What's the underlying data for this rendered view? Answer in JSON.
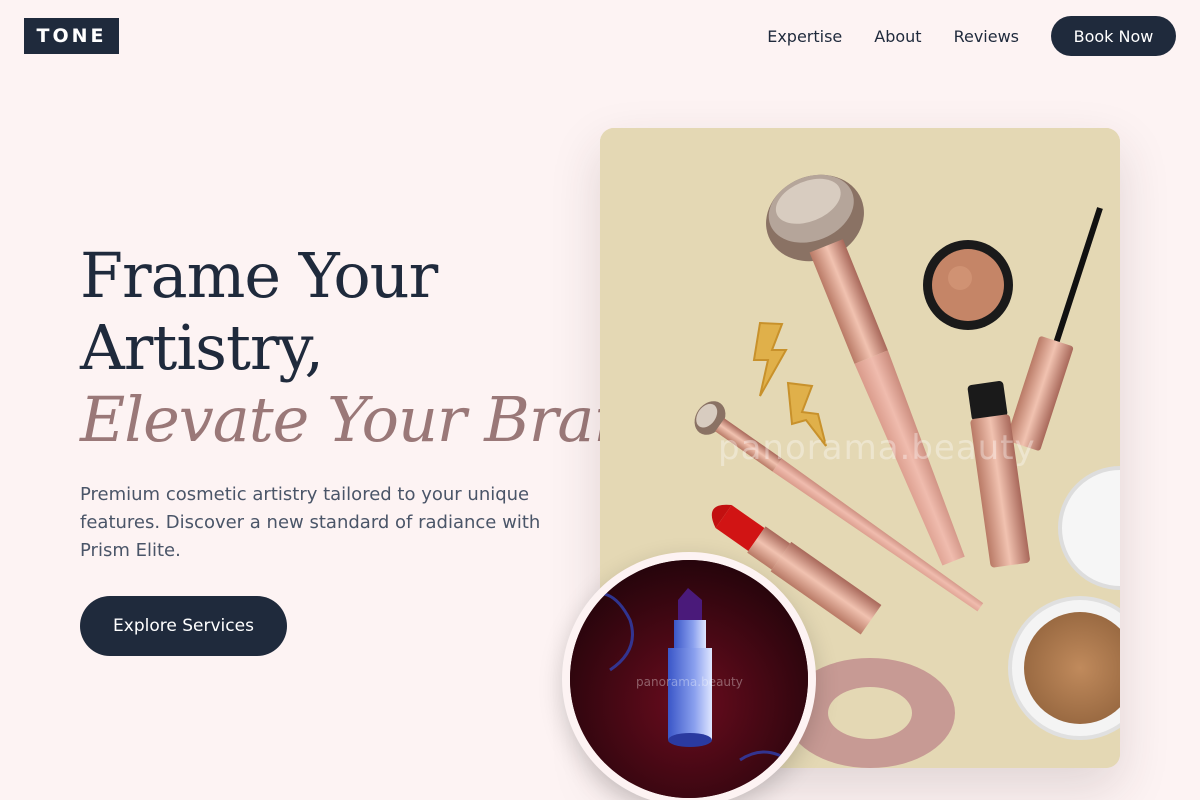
{
  "brand": {
    "logo": "TONE"
  },
  "nav": {
    "links": [
      "Expertise",
      "About",
      "Reviews"
    ],
    "cta": "Book Now"
  },
  "hero": {
    "headline_line1": "Frame Your",
    "headline_line2": "Artistry,",
    "headline_accent": "Elevate Your Brand.",
    "subtext": "Premium cosmetic artistry tailored to your unique features. Discover a new standard of radiance with Prism Elite.",
    "cta": "Explore Services"
  },
  "images": {
    "main_watermark": "panorama.beauty",
    "circle_watermark": "panorama.beauty"
  },
  "colors": {
    "background": "#fdf3f3",
    "primary": "#1f2a3c",
    "accent": "#9a7878",
    "card_bg": "#e4d8b4"
  }
}
